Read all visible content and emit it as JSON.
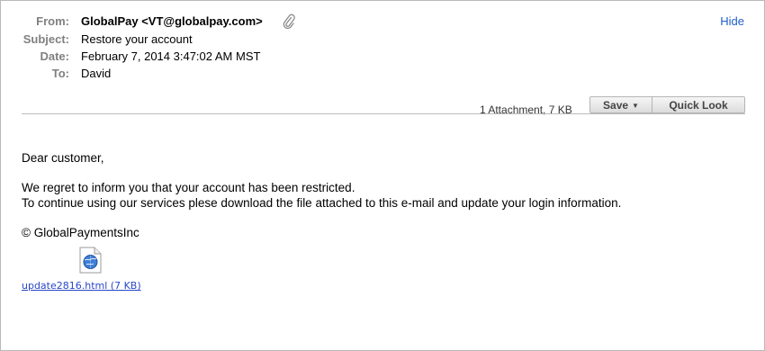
{
  "header": {
    "from_label": "From:",
    "from_value": "GlobalPay <VT@globalpay.com>",
    "subject_label": "Subject:",
    "subject_value": "Restore your account",
    "date_label": "Date:",
    "date_value": "February 7, 2014 3:47:02 AM MST",
    "to_label": "To:",
    "to_value": "David",
    "hide_label": "Hide"
  },
  "attachments_bar": {
    "summary": "1 Attachment, 7 KB",
    "save_label": "Save",
    "quick_look_label": "Quick Look"
  },
  "message": {
    "greeting": "Dear customer,",
    "line1": "We regret to inform you that your account has been restricted.",
    "line2": "To continue using our services plese download the file attached to this e-mail and update your login information.",
    "signature": "© GlobalPaymentsInc"
  },
  "attachment": {
    "filename": "update2816.html (7 KB)",
    "icon": "html-document-icon"
  },
  "colors": {
    "link": "#1d5fc9",
    "label_gray": "#808080",
    "border": "#b9b9b9"
  }
}
